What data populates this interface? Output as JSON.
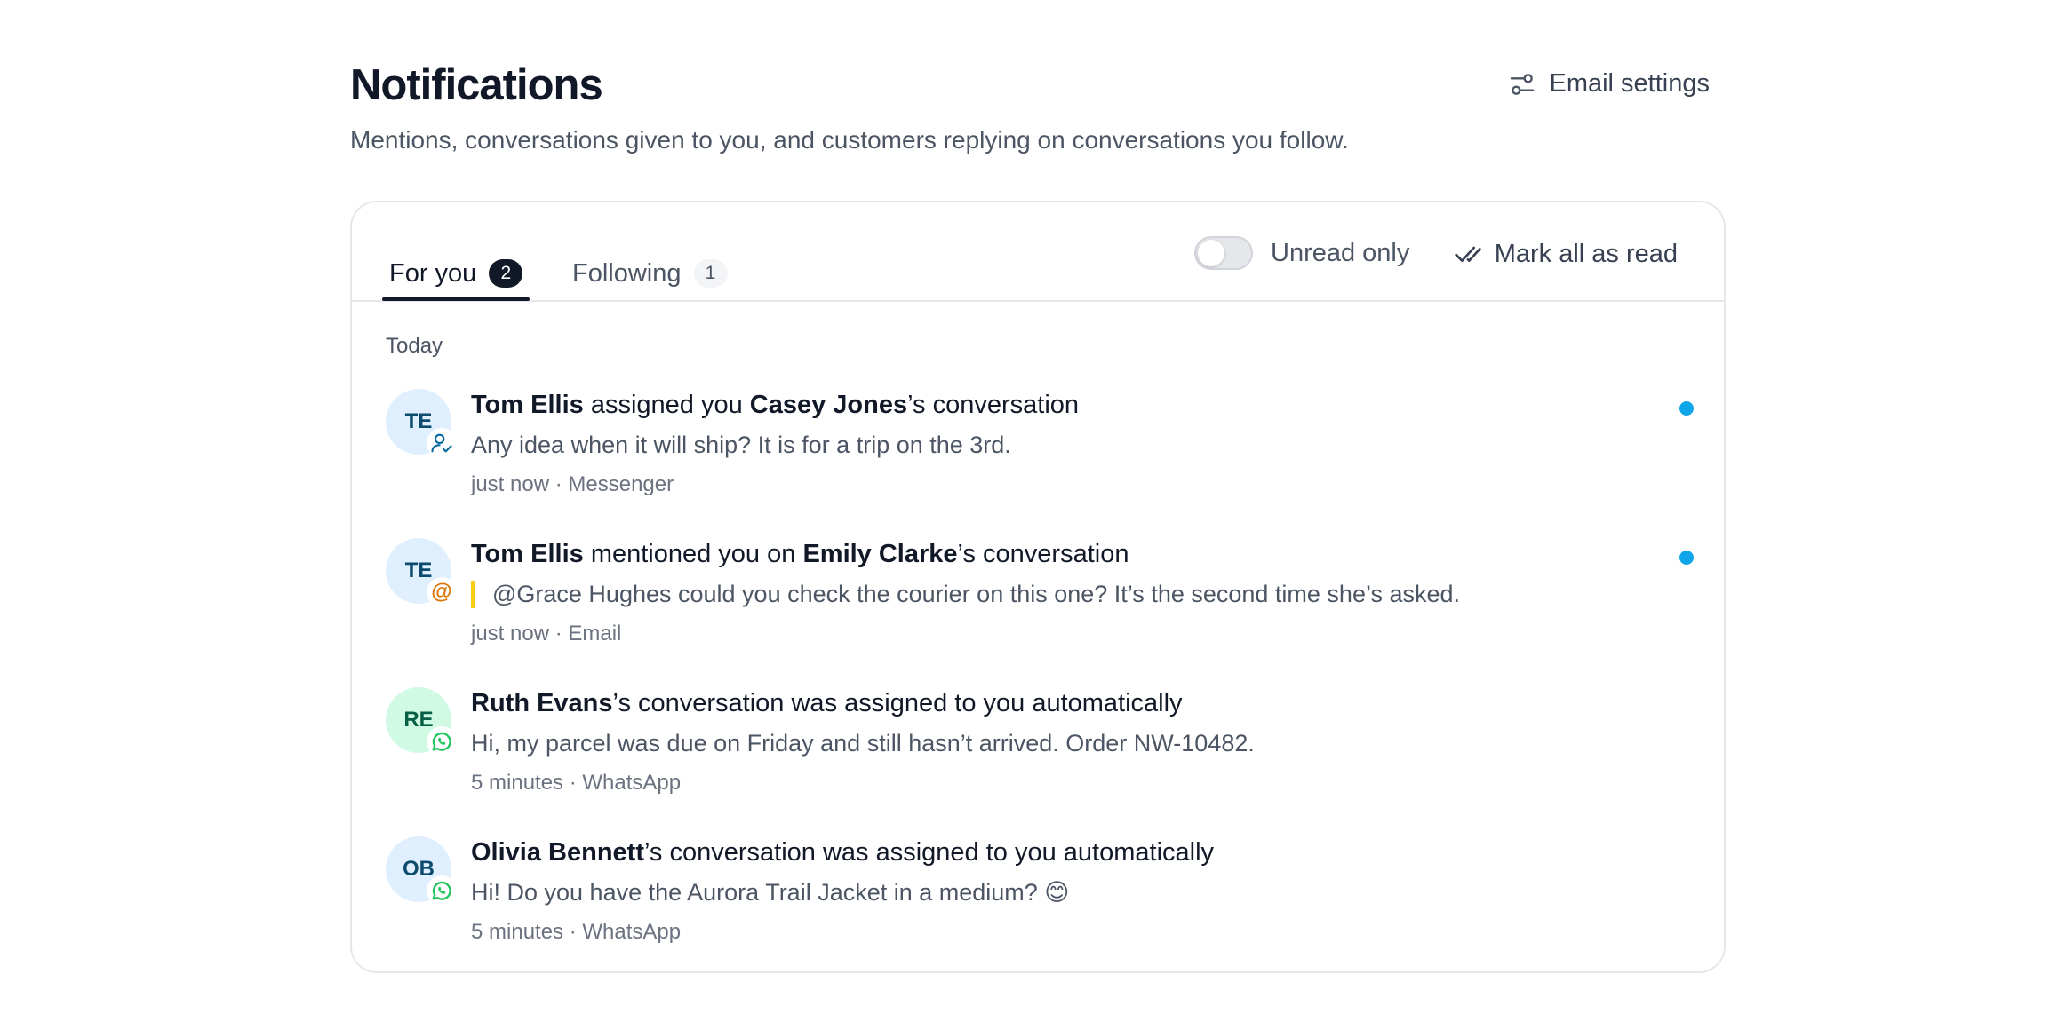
{
  "header": {
    "title": "Notifications",
    "subtitle": "Mentions, conversations given to you, and customers replying on conversations you follow.",
    "email_settings_label": "Email settings"
  },
  "tabs": [
    {
      "label": "For you",
      "count": "2",
      "active": true
    },
    {
      "label": "Following",
      "count": "1",
      "active": false
    }
  ],
  "controls": {
    "unread_only_label": "Unread only",
    "unread_only_on": false,
    "mark_all_label": "Mark all as read"
  },
  "group_label": "Today",
  "notifications": [
    {
      "initials": "TE",
      "actor": "Tom Ellis",
      "verb": " assigned you ",
      "target": "Casey Jones",
      "suffix": "’s conversation",
      "preview": "Any idea when it will ship? It is for a trip on the 3rd.",
      "time": "just now",
      "channel": "Messenger",
      "icon": "user-check-icon",
      "unread": true
    },
    {
      "initials": "TE",
      "actor": "Tom Ellis",
      "verb": " mentioned you on ",
      "target": "Emily Clarke",
      "suffix": "’s conversation",
      "preview": "@Grace Hughes could you check the courier on this one? It’s the second time she’s asked.",
      "time": "just now",
      "channel": "Email",
      "icon": "at-icon",
      "unread": true
    },
    {
      "initials": "RE",
      "actor": "Ruth Evans",
      "suffix": "’s conversation was assigned to you automatically",
      "preview": "Hi, my parcel was due on Friday and still hasn’t arrived. Order NW-10482.",
      "time": "5 minutes",
      "channel": "WhatsApp",
      "icon": "whatsapp-icon",
      "unread": false
    },
    {
      "initials": "OB",
      "actor": "Olivia Bennett",
      "suffix": "’s conversation was assigned to you automatically",
      "preview": "Hi! Do you have the Aurora Trail Jacket in a medium? 😊",
      "time": "5 minutes",
      "channel": "WhatsApp",
      "icon": "whatsapp-icon",
      "unread": false
    }
  ],
  "meta_separator": " · ",
  "colors": {
    "accent_dot": "#0ea5e9",
    "mention_bar": "#facc15",
    "whatsapp": "#22c55e"
  }
}
